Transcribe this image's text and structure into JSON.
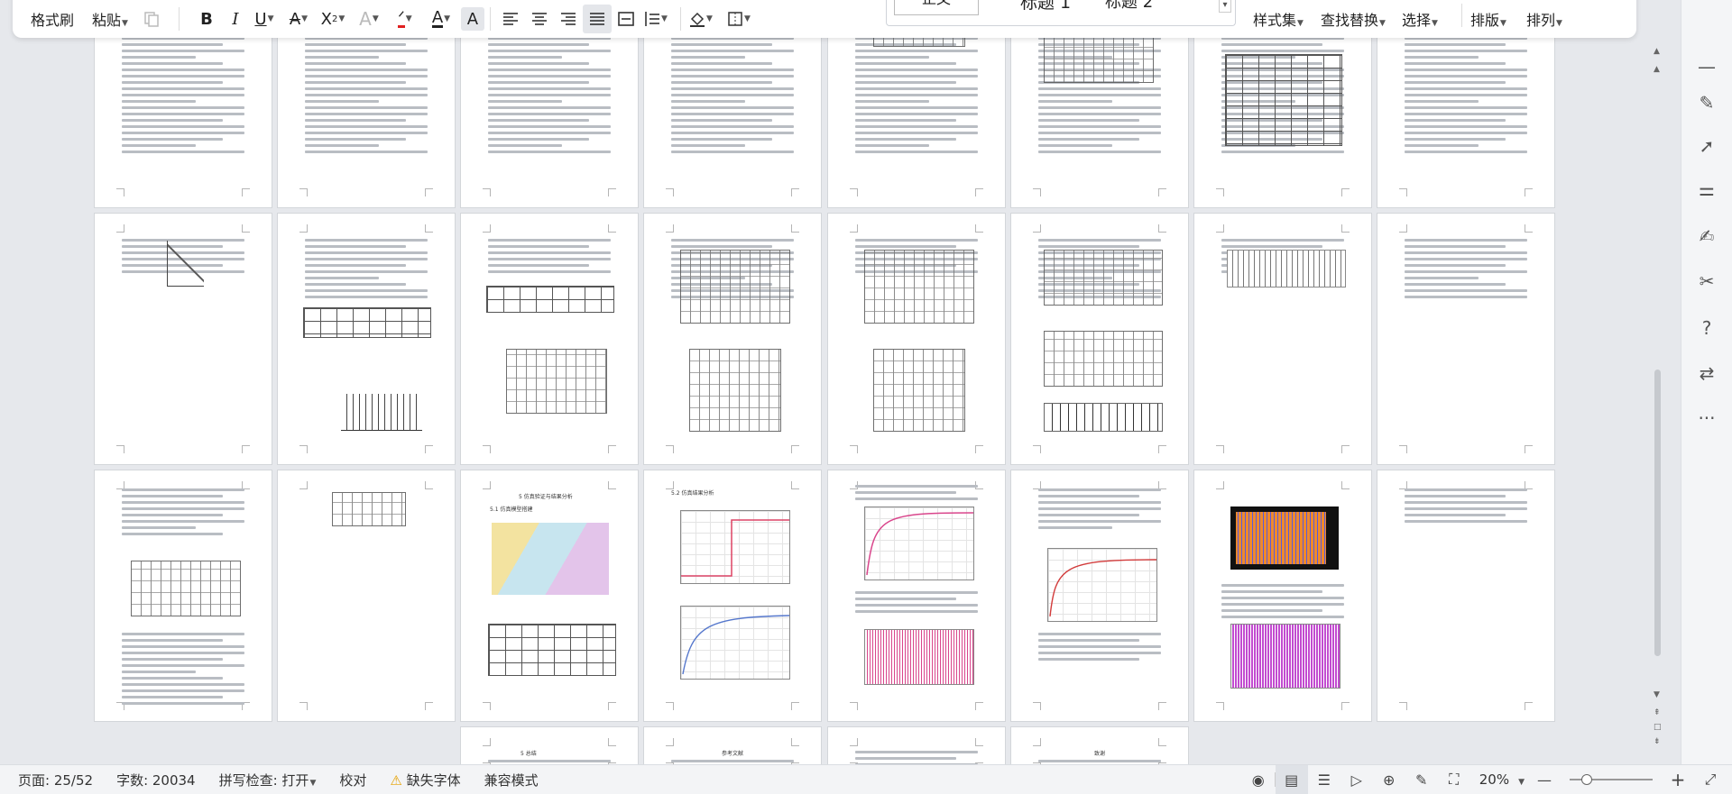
{
  "ribbon": {
    "format_painter": "格式刷",
    "paste": "粘贴",
    "styles_gallery": {
      "style1": "正文",
      "style2": "标题 1",
      "style3": "标题 2"
    },
    "style_set": "样式集",
    "find_replace": "查找替换",
    "select": "选择",
    "layout": "排版",
    "arrange": "排列",
    "icons": [
      "copy-icon",
      "bold-icon",
      "italic-icon",
      "underline-icon",
      "strikethrough-icon",
      "superscript-icon",
      "text-effect-icon",
      "highlight-color-icon",
      "font-color-icon",
      "char-shading-icon",
      "align-left-icon",
      "align-center-icon",
      "align-right-icon",
      "justify-icon",
      "distributed-icon",
      "line-spacing-icon",
      "fill-color-icon",
      "borders-icon"
    ]
  },
  "document": {
    "headings": {
      "p3_2": "5  仿真验证与结果分析",
      "p3_2_sub": "5.1  仿真模型搭建",
      "p3_3": "5.2  仿真结果分析",
      "p4_0": "5  总结",
      "p4_1": "参考文献",
      "p4_3": "致谢"
    },
    "colors": {
      "pink_plot": "#d9468c",
      "orange_plot": "#f08a2b",
      "purple_plot": "#c24bd0"
    }
  },
  "status": {
    "page": "页面: 25/52",
    "word_count": "字数: 20034",
    "spell_check": "拼写检查: 打开",
    "proofread": "校对",
    "missing_fonts": "缺失字体",
    "compat_mode": "兼容模式",
    "zoom": "20%",
    "zoom_fraction": 0.2
  }
}
